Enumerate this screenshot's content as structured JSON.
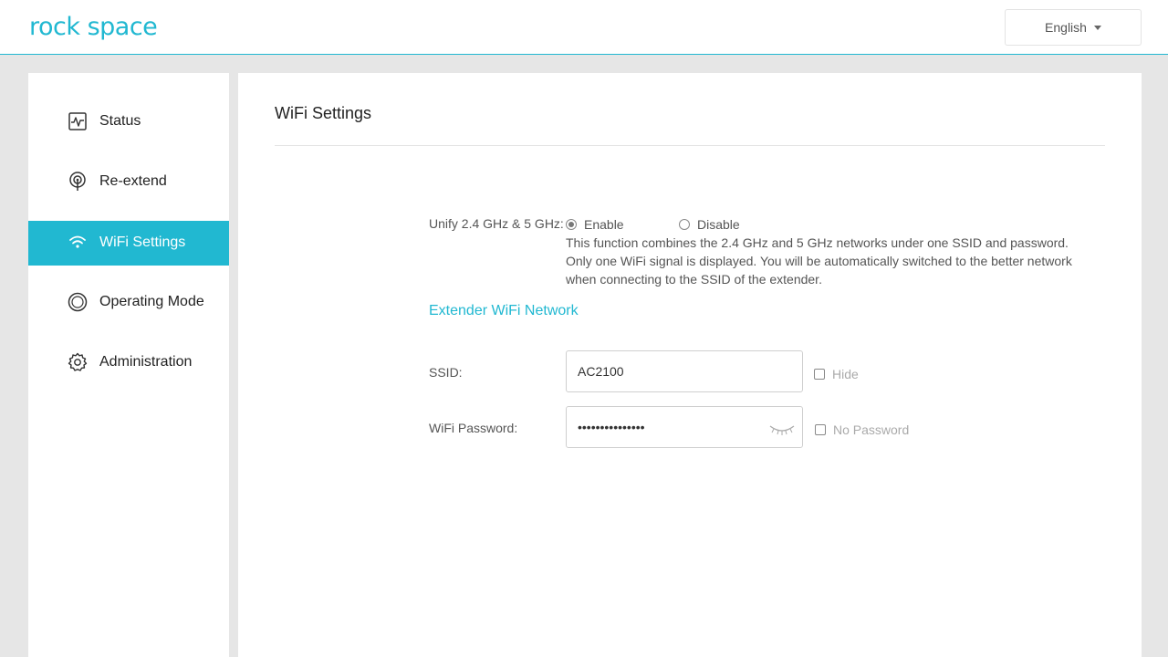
{
  "header": {
    "logo_text": "rock space",
    "language": "English"
  },
  "sidebar": {
    "items": [
      {
        "label": "Status",
        "icon": "activity-icon"
      },
      {
        "label": "Re-extend",
        "icon": "signal-tower-icon"
      },
      {
        "label": "WiFi Settings",
        "icon": "wifi-icon",
        "active": true
      },
      {
        "label": "Operating Mode",
        "icon": "mode-circle-icon"
      },
      {
        "label": "Administration",
        "icon": "gear-icon"
      }
    ]
  },
  "main": {
    "title": "WiFi Settings",
    "unify": {
      "label": "Unify 2.4 GHz & 5 GHz:",
      "enable_label": "Enable",
      "disable_label": "Disable",
      "selected": "Enable",
      "description": "This function combines the 2.4 GHz and 5 GHz networks under one SSID and password. Only one WiFi signal is displayed. You will be automatically switched to the better network when connecting to the SSID of the extender."
    },
    "section_title": "Extender WiFi Network",
    "ssid": {
      "label": "SSID:",
      "value": "AC2100",
      "hide_label": "Hide",
      "hide_checked": false
    },
    "password": {
      "label": "WiFi Password:",
      "value": "•••••••••••••••",
      "no_password_label": "No Password",
      "no_password_checked": false
    }
  },
  "colors": {
    "accent": "#21b8d1",
    "background": "#e6e6e6"
  }
}
